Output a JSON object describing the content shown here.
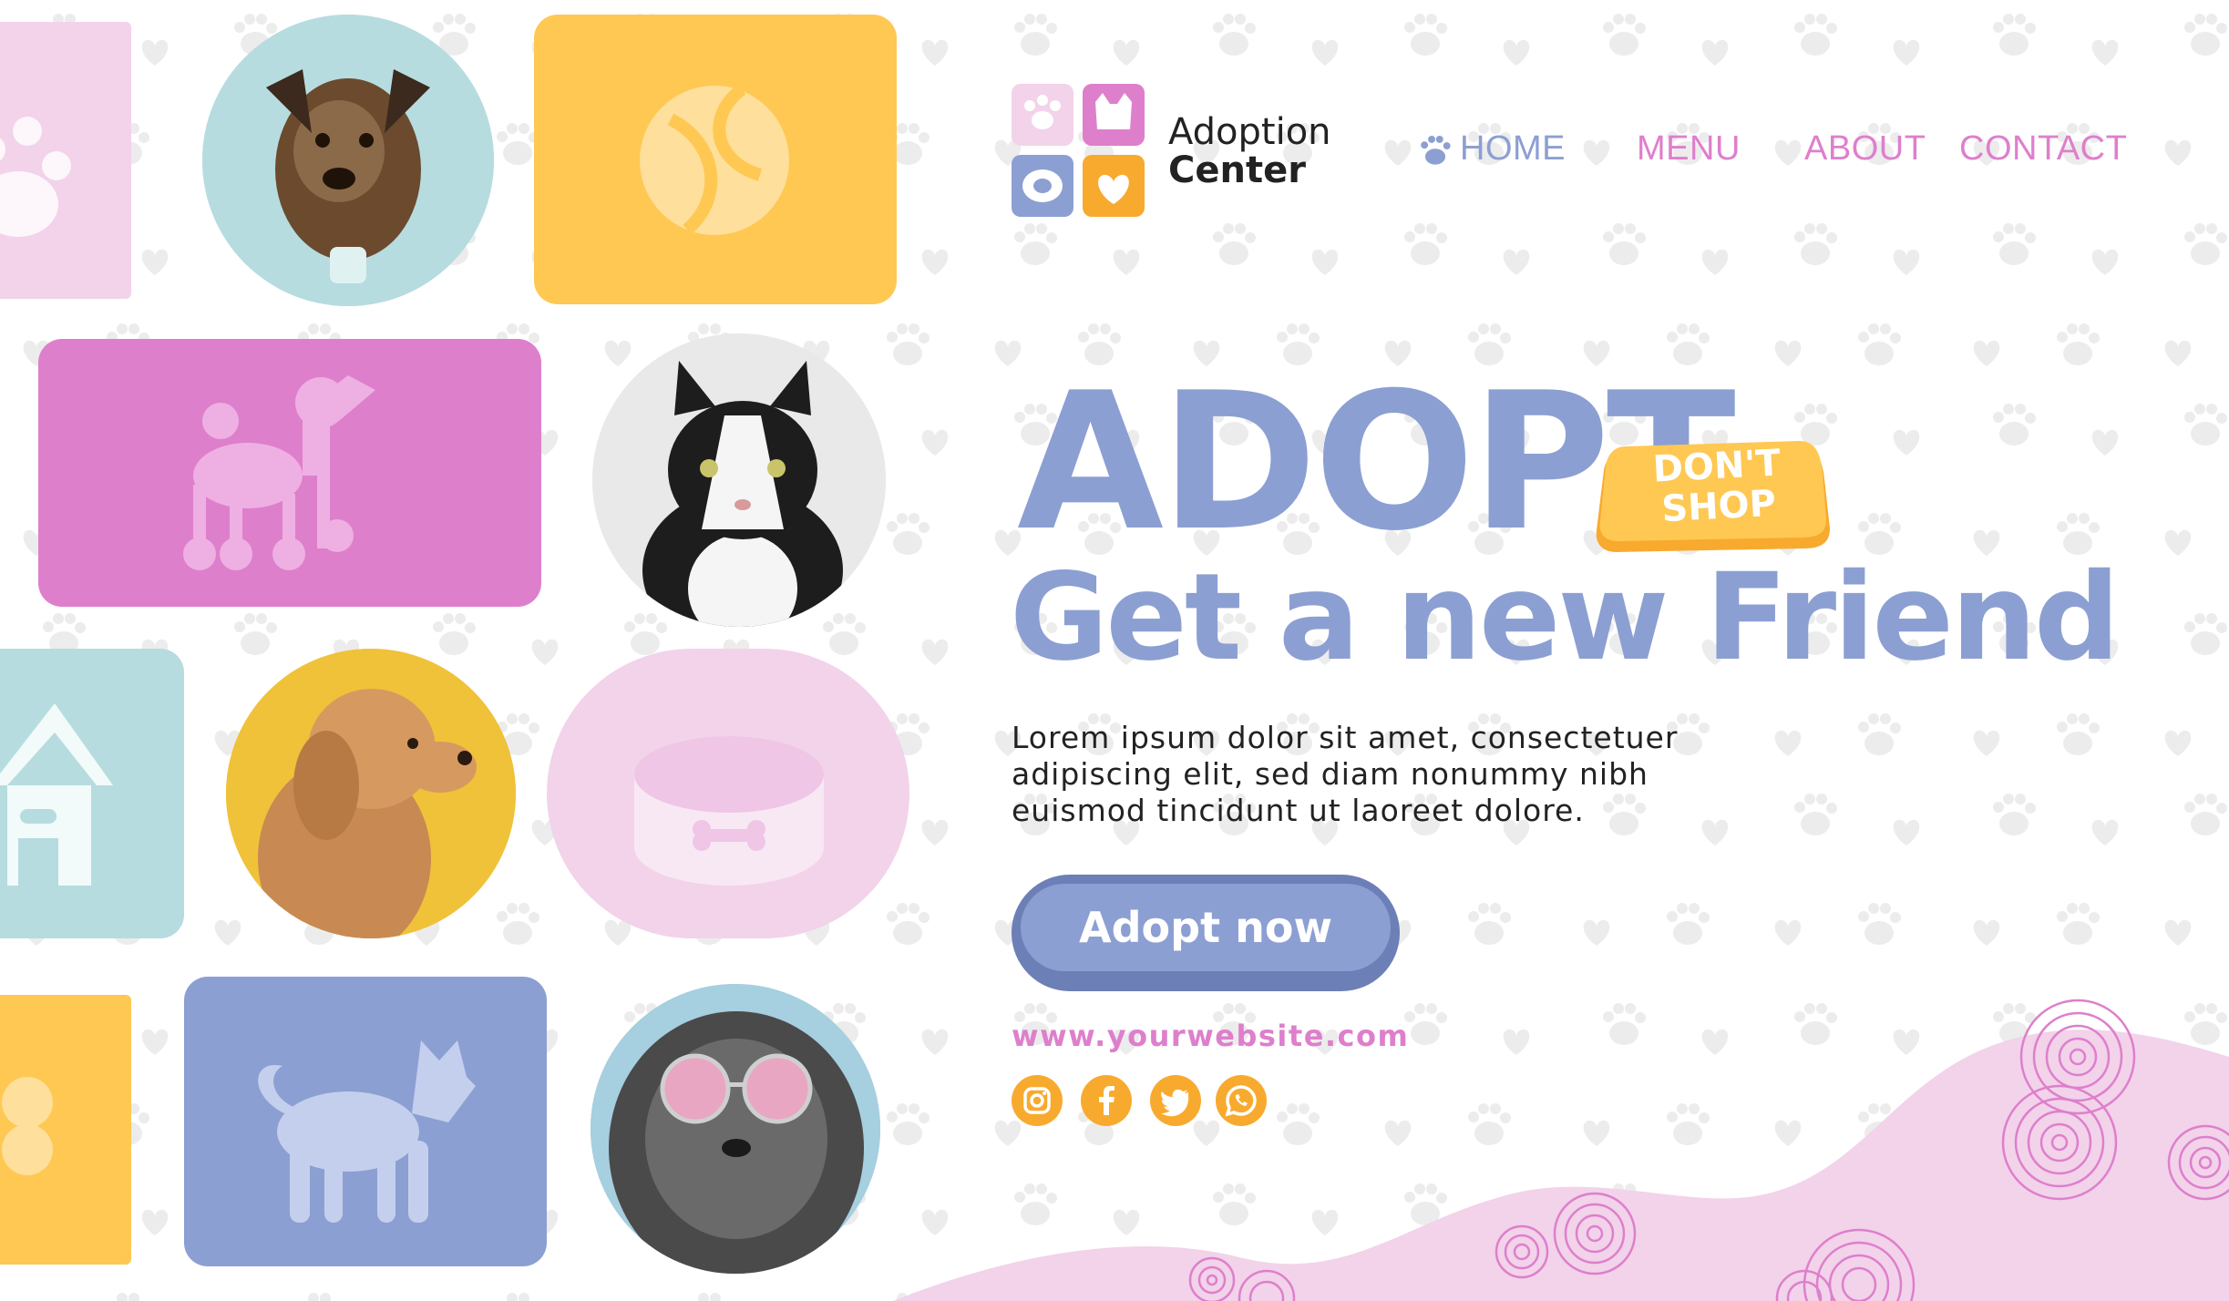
{
  "logo": {
    "line1": "Adoption",
    "line2": "Center",
    "icon_name": "pet-adoption-logo-icon"
  },
  "nav": {
    "home": "HOME",
    "menu": "MENU",
    "about": "ABOUT",
    "contact": "CONTACT",
    "home_icon": "paw-icon"
  },
  "hero": {
    "headline": "ADOPT",
    "badge_line1": "DON'T",
    "badge_line2": "SHOP",
    "subheadline": "Get a new Friend",
    "body_line1": "Lorem ipsum dolor sit amet, consectetuer",
    "body_line2": "adipiscing elit, sed diam nonummy nibh",
    "body_line3": "euismod tincidunt ut laoreet dolore.",
    "cta": "Adopt now",
    "url": "www.yourwebsite.com"
  },
  "social": [
    "instagram-icon",
    "facebook-icon",
    "twitter-icon",
    "whatsapp-icon"
  ],
  "colors": {
    "blue": "#8c9fd2",
    "pink": "#de7fcc",
    "light_pink": "#f2d3ea",
    "yellow": "#fec853",
    "teal": "#b6dcdf",
    "orange": "#f8aa2e"
  }
}
